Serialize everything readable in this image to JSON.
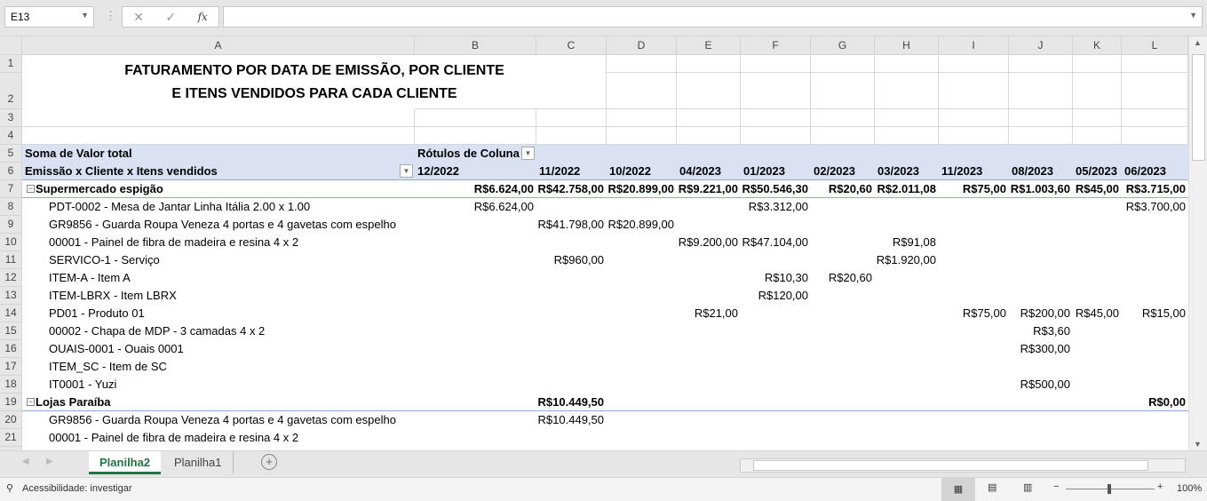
{
  "name_box": "E13",
  "formula_icons": {
    "cancel": "✕",
    "enter": "✓",
    "fx": "fx"
  },
  "columns": [
    "A",
    "B",
    "C",
    "D",
    "E",
    "F",
    "G",
    "H",
    "I",
    "J",
    "K",
    "L"
  ],
  "title_line1": "FATURAMENTO POR DATA DE EMISSÃO, POR CLIENTE",
  "title_line2": "E ITENS VENDIDOS PARA CADA CLIENTE",
  "pivot": {
    "values_label": "Soma de Valor total",
    "col_labels": "Rótulos de Coluna",
    "row_labels": "Emissão x Cliente x Itens vendidos",
    "periods": [
      "12/2022",
      "11/2022",
      "10/2022",
      "04/2023",
      "01/2023",
      "02/2023",
      "03/2023",
      "11/2023",
      "08/2023",
      "05/2023",
      "06/2023"
    ],
    "rows": [
      {
        "r": 7,
        "label": "Supermercado espigão",
        "group": true,
        "vals": [
          "R$6.624,00",
          "R$42.758,00",
          "R$20.899,00",
          "R$9.221,00",
          "R$50.546,30",
          "R$20,60",
          "R$2.011,08",
          "R$75,00",
          "R$1.003,60",
          "R$45,00",
          "R$3.715,00"
        ]
      },
      {
        "r": 8,
        "label": "PDT-0002 - Mesa de Jantar Linha Itália 2.00 x 1.00",
        "vals": [
          "R$6.624,00",
          "",
          "",
          "",
          "R$3.312,00",
          "",
          "",
          "",
          "",
          "",
          "R$3.700,00"
        ]
      },
      {
        "r": 9,
        "label": "GR9856 - Guarda Roupa Veneza 4 portas e 4 gavetas com espelho",
        "vals": [
          "",
          "R$41.798,00",
          "R$20.899,00",
          "",
          "",
          "",
          "",
          "",
          "",
          "",
          ""
        ]
      },
      {
        "r": 10,
        "label": "00001 - Painel de fibra de madeira e resina 4 x 2",
        "vals": [
          "",
          "",
          "",
          "R$9.200,00",
          "R$47.104,00",
          "",
          "R$91,08",
          "",
          "",
          "",
          ""
        ]
      },
      {
        "r": 11,
        "label": "SERVICO-1 - Serviço",
        "vals": [
          "",
          "R$960,00",
          "",
          "",
          "",
          "",
          "R$1.920,00",
          "",
          "",
          "",
          ""
        ]
      },
      {
        "r": 12,
        "label": "ITEM-A - Item A",
        "vals": [
          "",
          "",
          "",
          "",
          "R$10,30",
          "R$20,60",
          "",
          "",
          "",
          "",
          ""
        ]
      },
      {
        "r": 13,
        "label": "ITEM-LBRX - Item LBRX",
        "vals": [
          "",
          "",
          "",
          "",
          "R$120,00",
          "",
          "",
          "",
          "",
          "",
          ""
        ]
      },
      {
        "r": 14,
        "label": "PD01 - Produto 01",
        "vals": [
          "",
          "",
          "",
          "R$21,00",
          "",
          "",
          "",
          "R$75,00",
          "R$200,00",
          "R$45,00",
          "R$15,00"
        ]
      },
      {
        "r": 15,
        "label": "00002 - Chapa de MDP - 3 camadas 4 x 2",
        "vals": [
          "",
          "",
          "",
          "",
          "",
          "",
          "",
          "",
          "R$3,60",
          "",
          ""
        ]
      },
      {
        "r": 16,
        "label": "OUAIS-0001 - Ouais 0001",
        "vals": [
          "",
          "",
          "",
          "",
          "",
          "",
          "",
          "",
          "R$300,00",
          "",
          ""
        ]
      },
      {
        "r": 17,
        "label": "ITEM_SC - Item de SC",
        "vals": [
          "",
          "",
          "",
          "",
          "",
          "",
          "",
          "",
          "",
          "",
          ""
        ]
      },
      {
        "r": 18,
        "label": "IT0001 - Yuzi",
        "vals": [
          "",
          "",
          "",
          "",
          "",
          "",
          "",
          "",
          "R$500,00",
          "",
          ""
        ]
      },
      {
        "r": 19,
        "label": "Lojas Paraíba",
        "group": true,
        "vals": [
          "",
          "R$10.449,50",
          "",
          "",
          "",
          "",
          "",
          "",
          "",
          "",
          "R$0,00"
        ]
      },
      {
        "r": 20,
        "label": "GR9856 - Guarda Roupa Veneza 4 portas e 4 gavetas com espelho",
        "vals": [
          "",
          "R$10.449,50",
          "",
          "",
          "",
          "",
          "",
          "",
          "",
          "",
          ""
        ]
      },
      {
        "r": 21,
        "label": "00001 - Painel de fibra de madeira e resina 4 x 2",
        "vals": [
          "",
          "",
          "",
          "",
          "",
          "",
          "",
          "",
          "",
          "",
          ""
        ]
      }
    ]
  },
  "sheets": [
    "Planilha2",
    "Planilha1"
  ],
  "status": {
    "accessibility": "Acessibilidade: investigar",
    "zoom": "100%"
  },
  "colors": {
    "pivot_header": "#d9e1f2",
    "accent": "#217346"
  }
}
